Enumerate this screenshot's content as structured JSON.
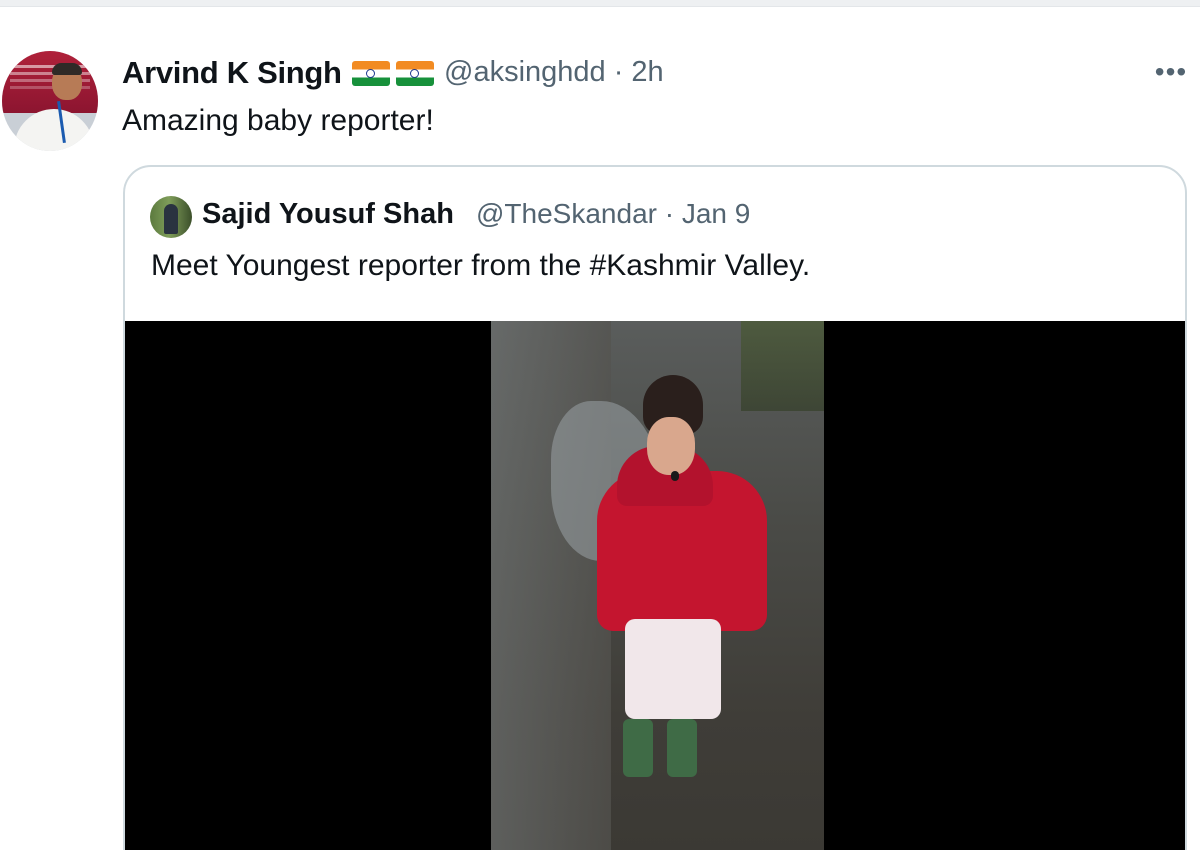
{
  "tweet": {
    "author_name": "Arvind K Singh",
    "author_flags": [
      "flag-india",
      "flag-india"
    ],
    "handle": "@aksinghdd",
    "meta": "· 2h",
    "text": "Amazing baby reporter!"
  },
  "more_menu": {
    "icon": "more-horizontal-icon",
    "label": "•••"
  },
  "quoted_tweet": {
    "author_name": "Sajid Yousuf Shah",
    "handle": "@TheSkandar",
    "meta": "· Jan 9",
    "text": "Meet Youngest reporter from the #Kashmir Valley.",
    "media": {
      "type": "video"
    }
  },
  "colors": {
    "text_primary": "#0f1419",
    "text_secondary": "#536471",
    "border": "#cfd9de",
    "media_bg": "#000000"
  }
}
